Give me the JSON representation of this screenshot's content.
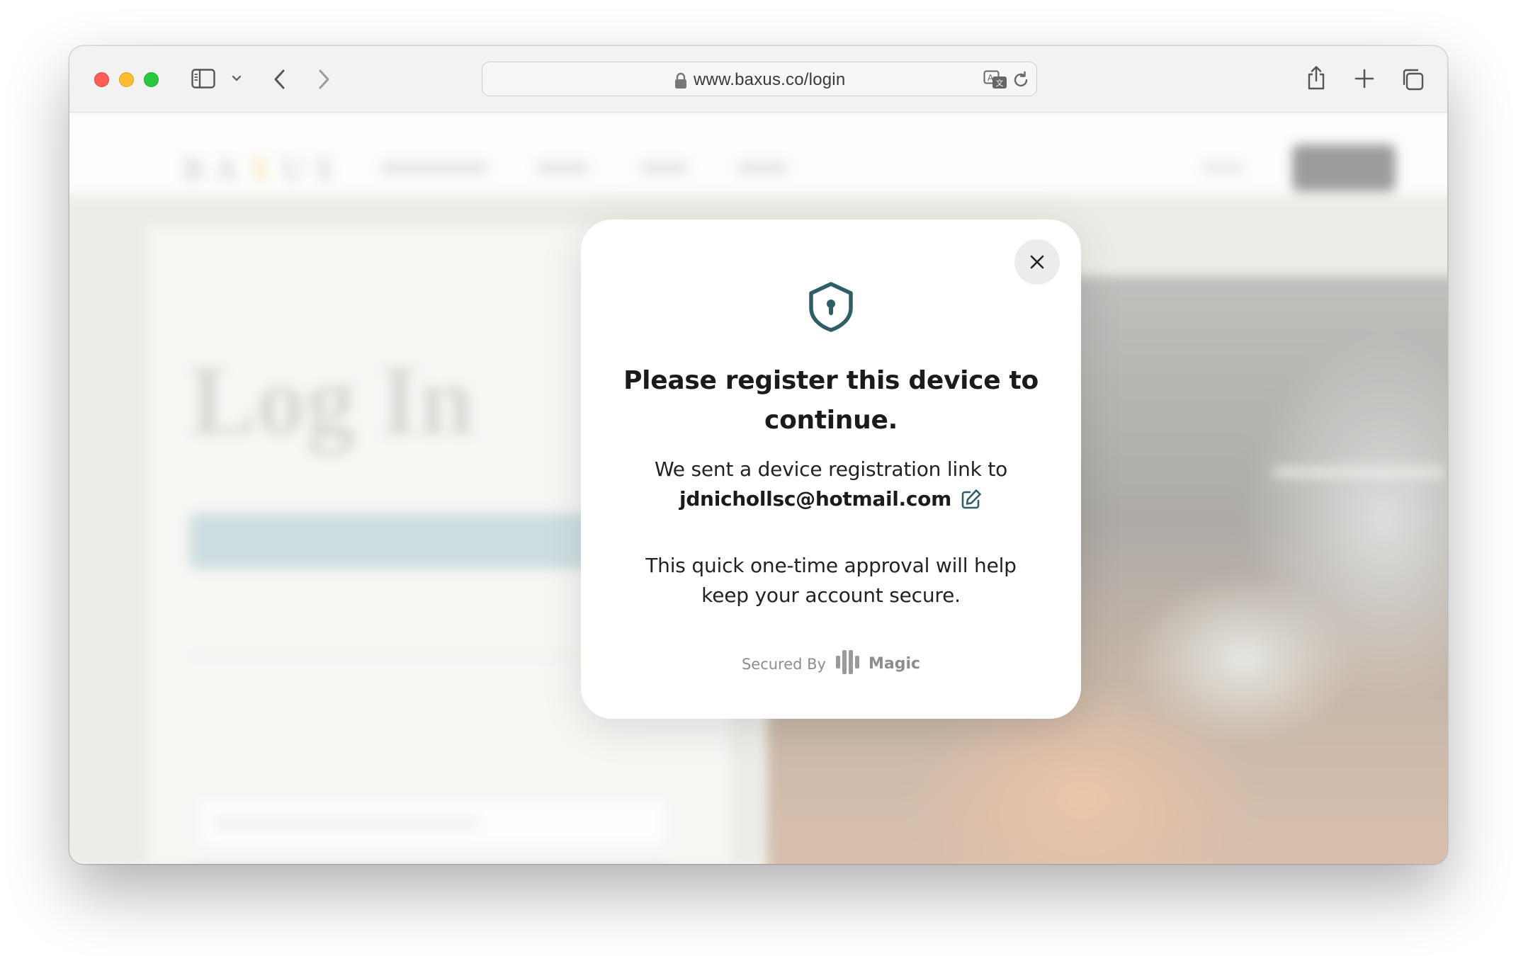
{
  "browser": {
    "url": "www.baxus.co/login",
    "icons": {
      "sidebar": "sidebar-icon",
      "tab_dropdown": "chevron-down-icon",
      "back": "chevron-left-icon",
      "forward": "chevron-right-icon",
      "lock": "lock-icon",
      "translate": "translate-icon",
      "reload": "reload-icon",
      "share": "share-icon",
      "new_tab": "plus-icon",
      "tab_overview": "tabs-icon"
    }
  },
  "modal": {
    "title": "Please register this device to continue.",
    "sent_text": "We sent a device registration link to",
    "email": "jdnichollsc@hotmail.com",
    "approval_text": "This quick one-time approval will help keep your account secure.",
    "secured_by": "Secured By",
    "provider": "Magic",
    "accent_color": "#2f5f66"
  }
}
